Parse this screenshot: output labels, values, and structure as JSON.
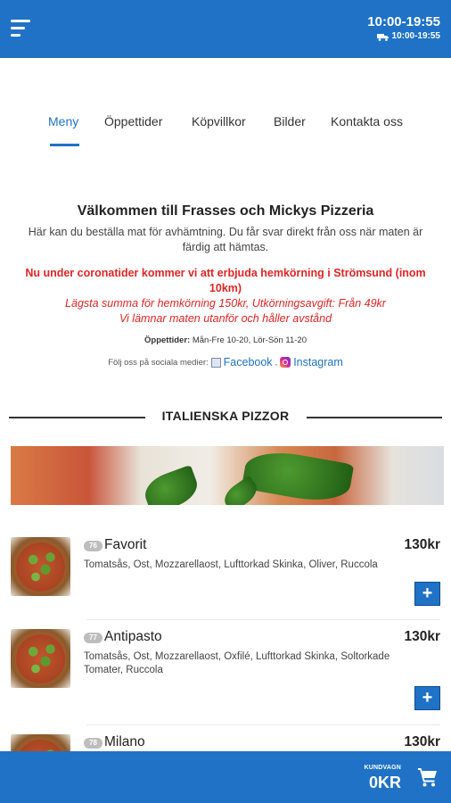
{
  "header": {
    "hours": "10:00-19:55",
    "delivery_hours": "10:00-19:55"
  },
  "tabs": [
    {
      "label": "Meny",
      "active": true
    },
    {
      "label": "Öppettider",
      "active": false
    },
    {
      "label": "Köpvillkor",
      "active": false
    },
    {
      "label": "Bilder",
      "active": false
    },
    {
      "label": "Kontakta oss",
      "active": false
    }
  ],
  "welcome": {
    "title": "Välkommen till Frasses och Mickys Pizzeria",
    "description": "Här kan du beställa mat för avhämtning. Du får svar direkt från oss när maten är färdig att hämtas.",
    "corona_notice": "Nu under coronatider kommer vi att erbjuda hemkörning i Strömsund (inom 10km)",
    "delivery_terms": "Lägsta summa för hemkörning 150kr, Utkörningsavgift: Från 49kr",
    "delivery_note": "Vi lämnar maten utanför och håller avstånd",
    "hours_label": "Öppettider:",
    "hours_value": "Mån-Fre 10-20, Lör-Sön 11-20",
    "social_label": "Följ oss på sociala medier:",
    "facebook": "Facebook",
    "separator": ",",
    "instagram": "Instagram"
  },
  "section": {
    "title": "ITALIENSKA PIZZOR"
  },
  "menu_items": [
    {
      "number": "76",
      "name": "Favorit",
      "price": "130kr",
      "description": "Tomatsås, Ost, Mozzarellaost, Lufttorkad Skinka, Oliver, Ruccola",
      "add_label": "+"
    },
    {
      "number": "77",
      "name": "Antipasto",
      "price": "130kr",
      "description": "Tomatsås, Ost, Mozzarellaost, Oxfilé, Lufttorkad Skinka, Soltorkade Tomater, Ruccola",
      "add_label": "+"
    },
    {
      "number": "78",
      "name": "Milano",
      "price": "130kr",
      "description": "",
      "add_label": "+"
    }
  ],
  "cart": {
    "label": "KUNDVAGN",
    "total": "0KR"
  },
  "colors": {
    "primary": "#1f72c6",
    "notice_red": "#e02424"
  },
  "icons": {
    "menu": "hamburger-icon",
    "delivery": "truck-icon",
    "cart": "shopping-cart-icon"
  }
}
